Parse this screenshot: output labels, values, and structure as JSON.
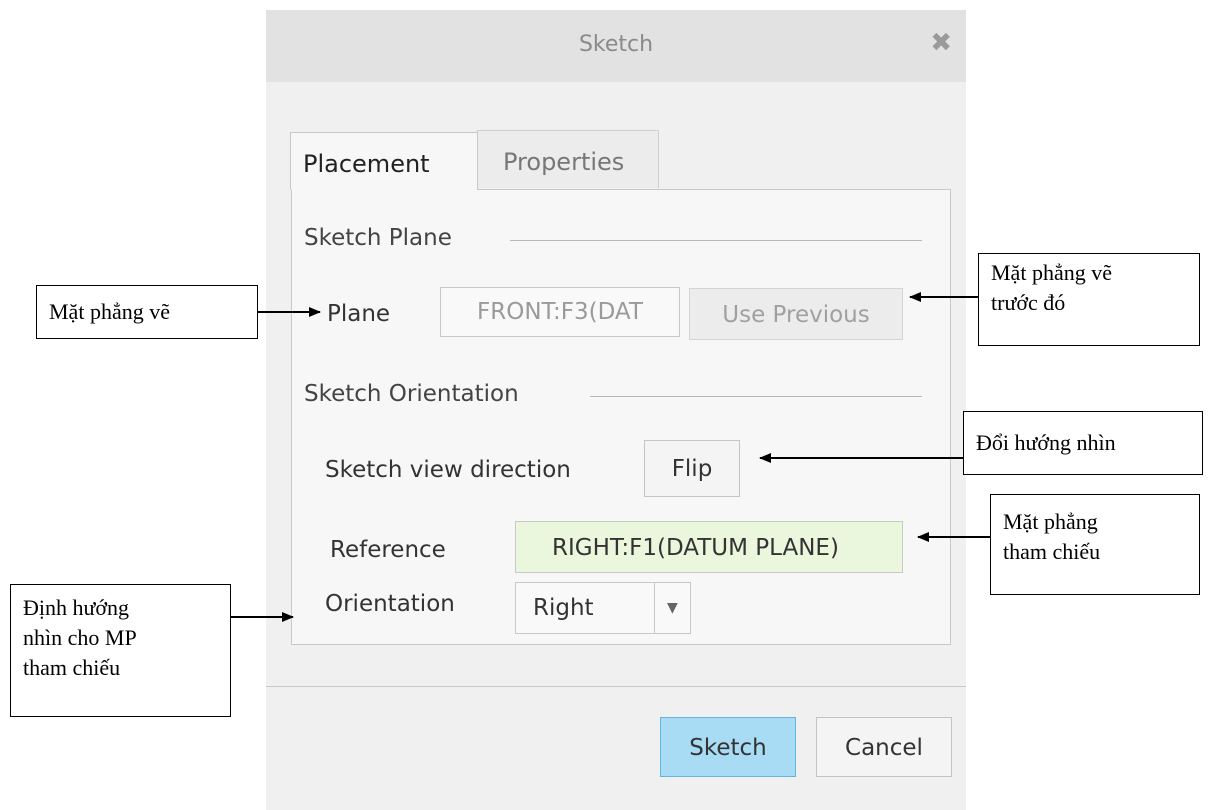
{
  "dialog": {
    "title": "Sketch",
    "close_glyph": "✖",
    "tabs": [
      {
        "label": "Placement",
        "active": true
      },
      {
        "label": "Properties",
        "active": false
      }
    ],
    "sketch_plane": {
      "section_label": "Sketch Plane",
      "plane_label": "Plane",
      "plane_value": "FRONT:F3(DAT",
      "use_previous_label": "Use Previous"
    },
    "sketch_orientation": {
      "section_label": "Sketch Orientation",
      "view_direction_label": "Sketch view direction",
      "flip_label": "Flip",
      "reference_label": "Reference",
      "reference_value": "RIGHT:F1(DATUM PLANE)",
      "orientation_label": "Orientation",
      "orientation_value": "Right"
    },
    "footer": {
      "sketch_button": "Sketch",
      "cancel_button": "Cancel"
    }
  },
  "annotations": {
    "plane": "Mặt phẳng vẽ",
    "previous_line1": "Mặt phẳng vẽ",
    "previous_line2": "trước đó",
    "flip": "Đổi hướng nhìn",
    "reference_line1": "Mặt phẳng",
    "reference_line2": "tham chiếu",
    "orientation_line1": "Định hướng",
    "orientation_line2": "nhìn cho MP",
    "orientation_line3": "tham chiếu"
  },
  "colors": {
    "reference_field_bg": "#eaf7dc",
    "sketch_button_bg": "#a8dcf5",
    "sketch_button_border": "#62b6e0"
  }
}
